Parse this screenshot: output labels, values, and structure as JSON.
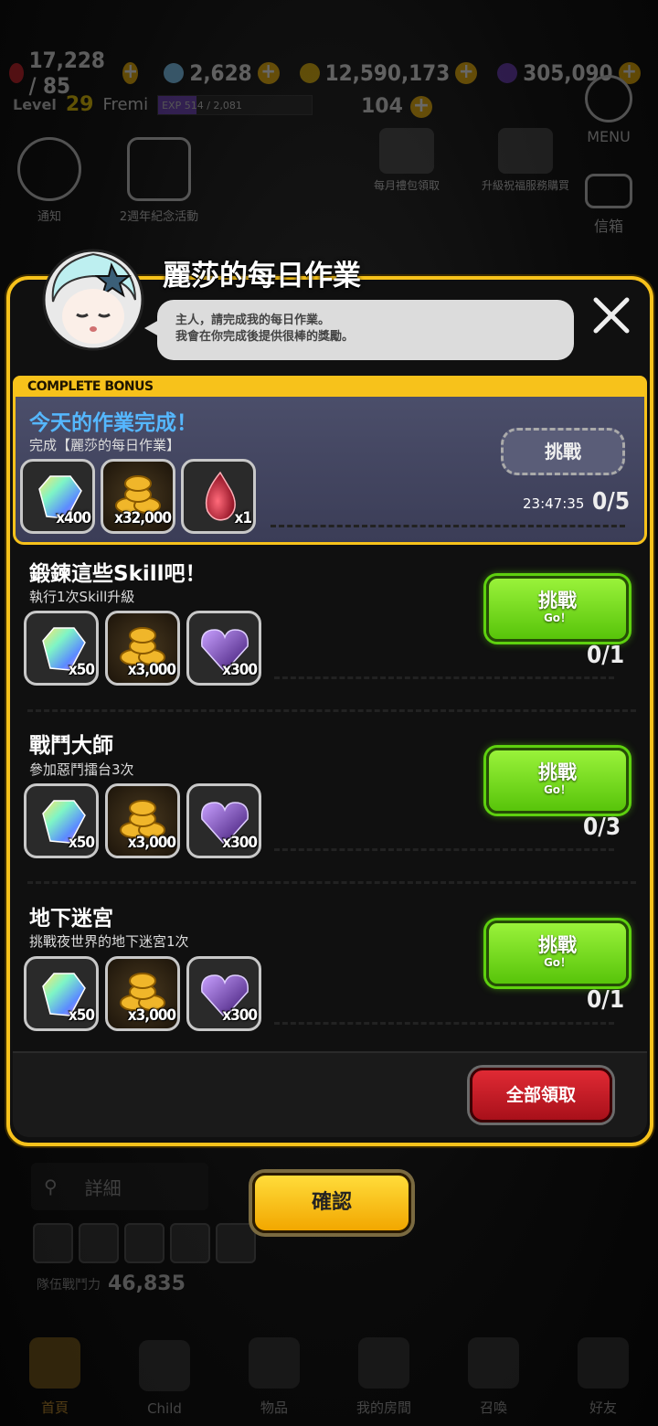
{
  "hud": {
    "stamina": "17,228 / 85",
    "gems": "2,628",
    "gold": "12,590,173",
    "tickets": "305,090",
    "level_prefix": "Level",
    "level": "29",
    "player_name": "Fremi",
    "exp": "EXP 514 / 2,081",
    "exp_fraction": 0.25,
    "energy": "104",
    "menu_label": "MENU",
    "mail_label": "信箱",
    "event_label": "通知",
    "anniv_label": "2週年紀念活動",
    "monthly_pack": "每月禮包領取",
    "level_pack": "升級祝福服務購買"
  },
  "modal": {
    "title": "麗莎的每日作業",
    "speech_line1": "主人，請完成我的每日作業。",
    "speech_line2": "我會在你完成後提供很棒的獎勵。",
    "complete_bonus": "COMPLETE BONUS",
    "bonus": {
      "title": "今天的作業完成！",
      "subtitle": "完成【麗莎的每日作業】",
      "button": "挑戰",
      "timer": "23:47:35",
      "progress": "0/5",
      "rewards": [
        {
          "icon": "rainbow-gem-icon",
          "qty": "x400"
        },
        {
          "icon": "gold-coins-icon",
          "qty": "x32,000"
        },
        {
          "icon": "red-crystal-icon",
          "qty": "x1"
        }
      ]
    },
    "tasks": [
      {
        "title": "鍛鍊這些Skill吧！",
        "subtitle": "執行1次Skill升級",
        "button": "挑戰",
        "button_sub": "Go！",
        "progress": "0/1",
        "rewards": [
          {
            "icon": "rainbow-gem-icon",
            "qty": "x50"
          },
          {
            "icon": "gold-coins-icon",
            "qty": "x3,000"
          },
          {
            "icon": "purple-heart-gem-icon",
            "qty": "x300"
          }
        ]
      },
      {
        "title": "戰鬥大師",
        "subtitle": "參加惡鬥擂台3次",
        "button": "挑戰",
        "button_sub": "Go！",
        "progress": "0/3",
        "rewards": [
          {
            "icon": "rainbow-gem-icon",
            "qty": "x50"
          },
          {
            "icon": "gold-coins-icon",
            "qty": "x3,000"
          },
          {
            "icon": "purple-heart-gem-icon",
            "qty": "x300"
          }
        ]
      },
      {
        "title": "地下迷宮",
        "subtitle": "挑戰夜世界的地下迷宮1次",
        "button": "挑戰",
        "button_sub": "Go！",
        "progress": "0/1",
        "rewards": [
          {
            "icon": "rainbow-gem-icon",
            "qty": "x50"
          },
          {
            "icon": "gold-coins-icon",
            "qty": "x3,000"
          },
          {
            "icon": "purple-heart-gem-icon",
            "qty": "x300"
          }
        ]
      }
    ],
    "claim_all": "全部領取",
    "confirm": "確認"
  },
  "background": {
    "search_label": "詳細",
    "team_power_label": "隊伍戰鬥力",
    "team_power": "46,835",
    "nav": [
      {
        "label": "首頁",
        "icon": "home-icon"
      },
      {
        "label": "Child",
        "icon": "child-icon"
      },
      {
        "label": "物品",
        "icon": "equipment-icon"
      },
      {
        "label": "我的房間",
        "icon": "room-icon"
      },
      {
        "label": "召喚",
        "icon": "summon-icon"
      },
      {
        "label": "好友",
        "icon": "friends-icon"
      }
    ]
  },
  "colors": {
    "frame": "#f7c21b",
    "go_button": "#6fd81a",
    "claim_button": "#c81c26",
    "confirm_button": "#f7c21b",
    "bonus_title": "#55b7ff"
  }
}
